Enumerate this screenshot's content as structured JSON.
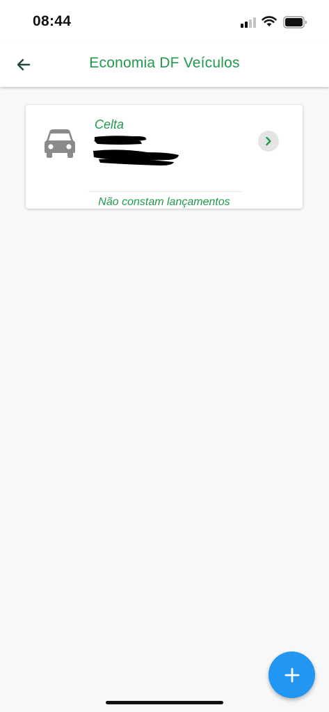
{
  "status_bar": {
    "time": "08:44",
    "icons": [
      "signal-icon",
      "wifi-icon",
      "battery-icon"
    ]
  },
  "app_bar": {
    "title": "Economia DF Veículos",
    "back_icon": "arrow-left-icon"
  },
  "vehicles": [
    {
      "name": "Celta",
      "icon": "car-icon",
      "details_redacted": true,
      "status": "Não constam lançamentos",
      "action_icon": "chevron-right-icon"
    }
  ],
  "fab": {
    "icon": "plus-icon"
  },
  "colors": {
    "brand_green": "#1f9a49",
    "fab_blue": "#2296f3",
    "background": "#f8f8f8",
    "icon_gray": "#8a8a8a"
  }
}
